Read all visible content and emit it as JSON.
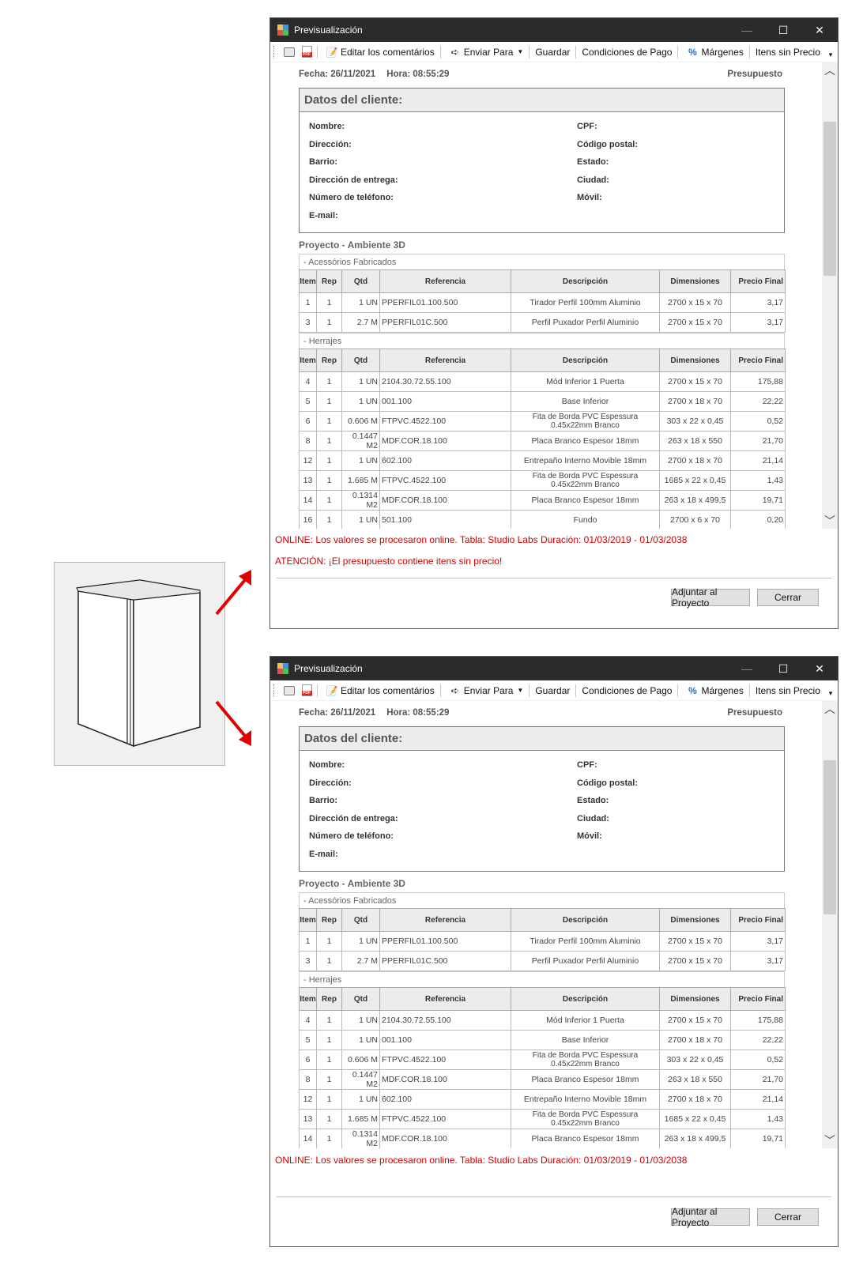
{
  "window": {
    "title": "Previsualización",
    "minimize": "—",
    "maximize": "☐",
    "close": "✕"
  },
  "toolbar": {
    "edit_comments": "Editar los comentários",
    "send_to": "Enviar Para",
    "save": "Guardar",
    "payment_conditions": "Condiciones de Pago",
    "margins": "Márgenes",
    "items_no_price": "Itens sin Precio"
  },
  "header": {
    "date": "Fecha: 26/11/2021",
    "time": "Hora: 08:55:29",
    "doc_type": "Presupuesto"
  },
  "client": {
    "title": "Datos del cliente:",
    "left_fields": [
      "Nombre:",
      "Dirección:",
      "Barrio:",
      "Dirección de entrega:",
      "Número de teléfono:",
      "E-mail:"
    ],
    "right_fields": [
      "CPF:",
      "Código postal:",
      "Estado:",
      "Ciudad:",
      "Móvil:"
    ]
  },
  "project_title": "Proyecto - Ambiente 3D",
  "columns": [
    "Item",
    "Rep",
    "Qtd",
    "Referencia",
    "Descripción",
    "Dimensiones",
    "Precio Final"
  ],
  "sections": [
    {
      "label": "- Acessórios Fabricados",
      "rows": [
        [
          "1",
          "1",
          "1 UN",
          "PPERFIL01.100.500",
          "Tirador Perfil 100mm Aluminio",
          "2700 x 15 x 70",
          "3,17"
        ],
        [
          "3",
          "1",
          "2.7 M",
          "PPERFIL01C.500",
          "Perfil Puxador Perfil Aluminio",
          "2700 x 15 x 70",
          "3,17"
        ]
      ]
    },
    {
      "label": "- Herrajes",
      "rows": [
        [
          "4",
          "1",
          "1 UN",
          "2104.30.72.55.100",
          "Mód Inferior 1 Puerta",
          "2700 x 15 x 70",
          "175,88"
        ],
        [
          "5",
          "1",
          "1 UN",
          "001.100",
          "Base Inferior",
          "2700 x 18 x 70",
          "22,22"
        ],
        [
          "6",
          "1",
          "0.606 M",
          "FTPVC.4522.100",
          "Fita de Borda PVC Espessura 0.45x22mm Branco",
          "303 x 22 x 0,45",
          "0,52"
        ],
        [
          "8",
          "1",
          "0.1447 M2",
          "MDF.COR.18.100",
          "Placa Branco Espesor 18mm",
          "263 x 18 x 550",
          "21,70"
        ],
        [
          "12",
          "1",
          "1 UN",
          "602.100",
          "Entrepaño Interno Movible 18mm",
          "2700 x 18 x 70",
          "21,14"
        ],
        [
          "13",
          "1",
          "1.685 M",
          "FTPVC.4522.100",
          "Fita de Borda PVC Espessura 0.45x22mm Branco",
          "1685 x 22 x 0,45",
          "1,43"
        ],
        [
          "14",
          "1",
          "0.1314 M2",
          "MDF.COR.18.100",
          "Placa Branco Espesor 18mm",
          "263 x 18 x 499,5",
          "19,71"
        ],
        [
          "16",
          "1",
          "1 UN",
          "501.100",
          "Fundo",
          "2700 x 6 x 70",
          "0,20"
        ]
      ]
    }
  ],
  "messages": {
    "online": "ONLINE: Los valores se procesaron online. Tabla: Studio Labs Duración: 01/03/2019 - 01/03/2038",
    "warning": "ATENCIÓN: ¡El presupuesto contiene itens sin precio!"
  },
  "buttons": {
    "adjust": "Adjuntar al Proyecto",
    "close": "Cerrar"
  },
  "colors": {
    "titlebar": "#2b2b2b",
    "warning_text": "#d40000",
    "arrow": "#e00000"
  }
}
